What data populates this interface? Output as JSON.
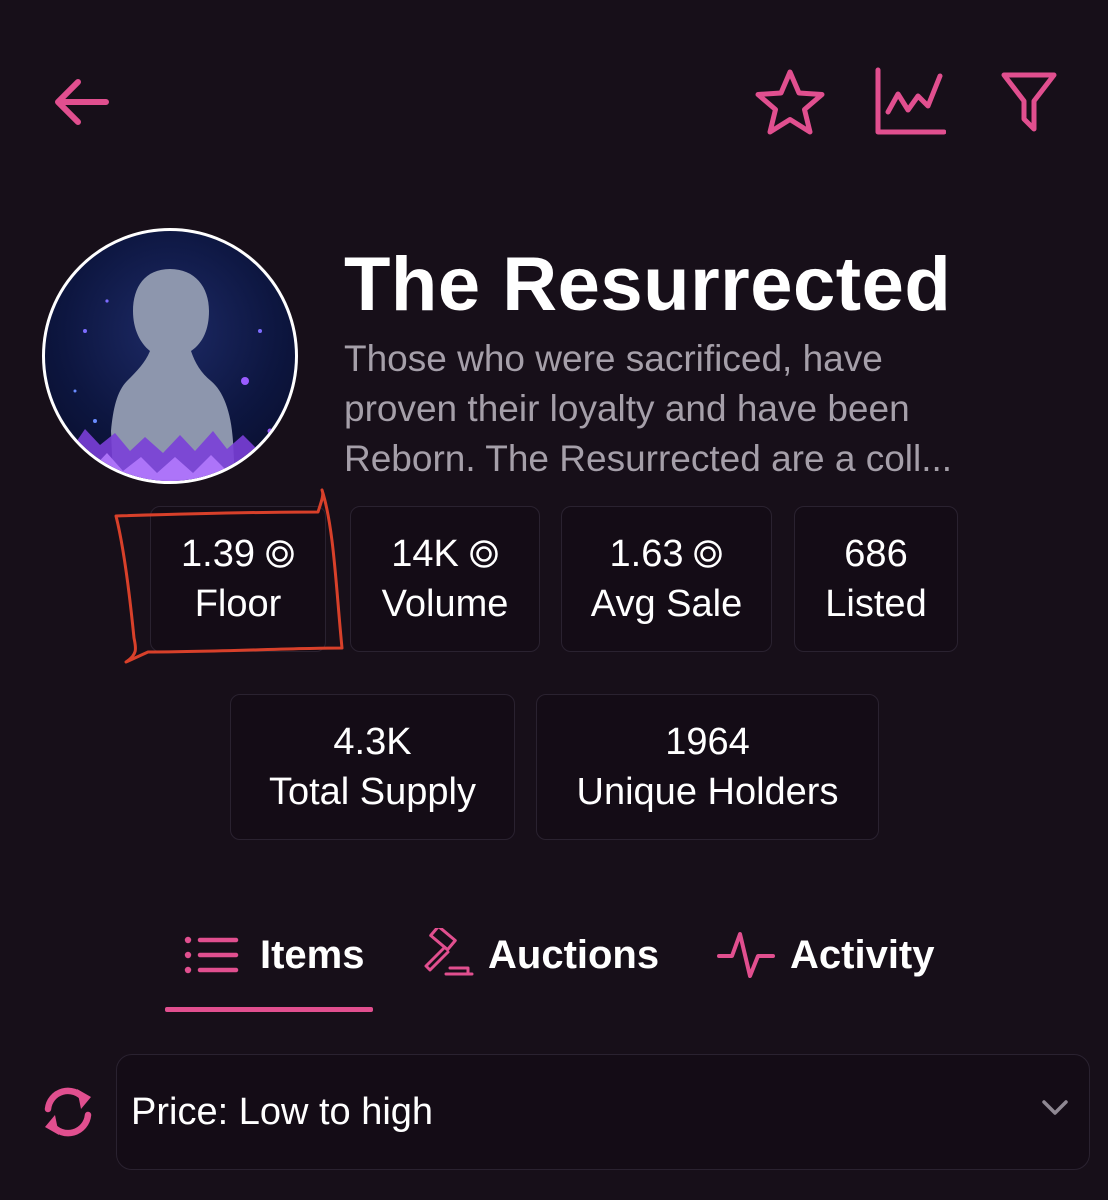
{
  "colors": {
    "background": "#170f19",
    "accent": "#e14f8f",
    "card_border": "#2a2230",
    "muted_text": "#a59fa9",
    "annotation": "#d8402a"
  },
  "header": {
    "back_icon": "arrow-left-icon",
    "favorite_icon": "star-icon",
    "chart_icon": "line-chart-icon",
    "filter_icon": "filter-icon"
  },
  "collection": {
    "avatar_icon": "collection-avatar",
    "title": "The Resurrected",
    "description_lines": [
      "Those who were sacrificed, have",
      "proven their loyalty and have been",
      "Reborn. The Resurrected are a coll..."
    ]
  },
  "stats": {
    "floor": {
      "value": "1.39",
      "label": "Floor",
      "currency_icon": "sol-icon"
    },
    "volume": {
      "value": "14K",
      "label": "Volume",
      "currency_icon": "sol-icon"
    },
    "avg_sale": {
      "value": "1.63",
      "label": "Avg Sale",
      "currency_icon": "sol-icon"
    },
    "listed": {
      "value": "686",
      "label": "Listed"
    },
    "total_supply": {
      "value": "4.3K",
      "label": "Total Supply"
    },
    "unique_holders": {
      "value": "1964",
      "label": "Unique Holders"
    }
  },
  "tabs": [
    {
      "label": "Items",
      "icon": "list-icon",
      "active": true
    },
    {
      "label": "Auctions",
      "icon": "gavel-icon",
      "active": false
    },
    {
      "label": "Activity",
      "icon": "pulse-icon",
      "active": false
    }
  ],
  "sort": {
    "refresh_icon": "refresh-icon",
    "selected": "Price: Low to high",
    "dropdown_icon": "chevron-down-icon"
  }
}
